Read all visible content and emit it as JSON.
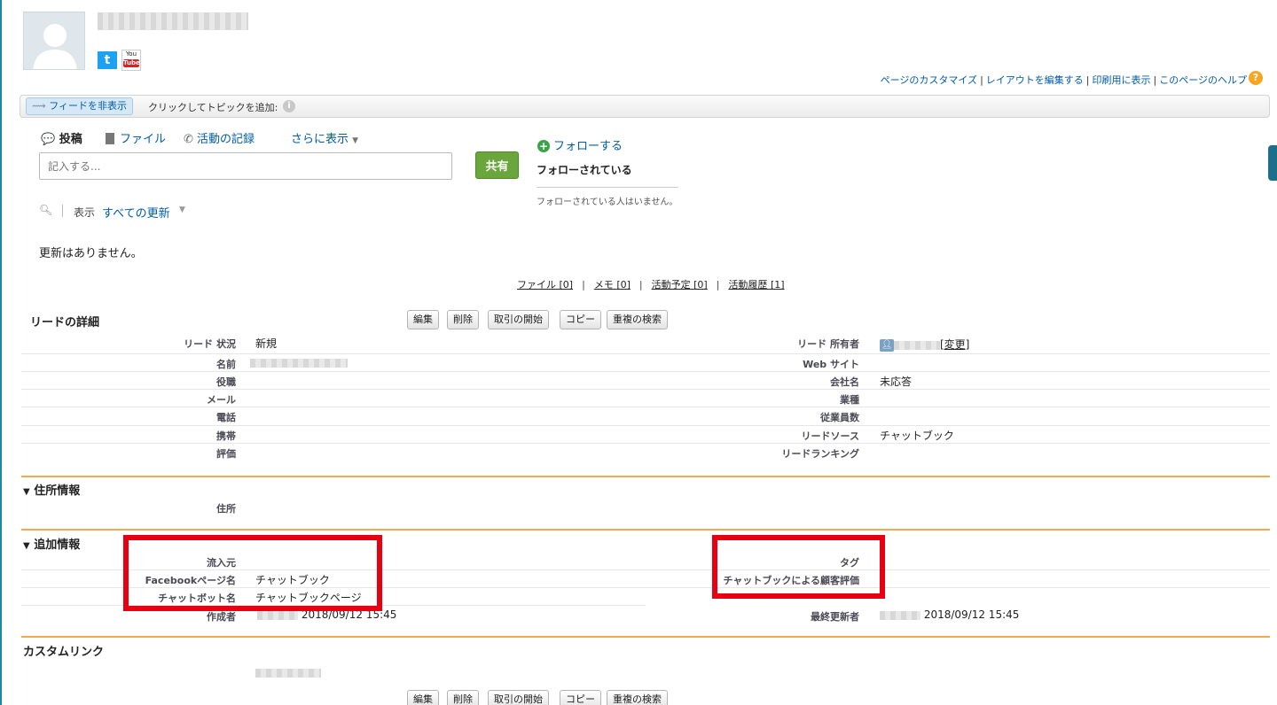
{
  "header": {
    "toplinks": [
      "ページのカスタマイズ",
      "レイアウトを編集する",
      "印刷用に表示",
      "このページのヘルプ"
    ]
  },
  "feed": {
    "hide_feed": "フィードを非表示",
    "add_topic": "クリックしてトピックを追加:",
    "tabs": [
      "投稿",
      "ファイル",
      "活動の記録",
      "さらに表示"
    ],
    "input_placeholder": "記入する...",
    "share": "共有",
    "follow": "フォローする",
    "followers_title": "フォローされている",
    "no_followers": "フォローされている人はいません。",
    "filter_label": "表示",
    "filter_value": "すべての更新",
    "no_updates": "更新はありません。"
  },
  "related_links": [
    {
      "label": "ファイル",
      "count": "[0]"
    },
    {
      "label": "メモ",
      "count": "[0]"
    },
    {
      "label": "活動予定",
      "count": "[0]"
    },
    {
      "label": "活動履歴",
      "count": "[1]"
    }
  ],
  "detail": {
    "title": "リードの詳細",
    "buttons": [
      "編集",
      "削除",
      "取引の開始",
      "コピー",
      "重複の検索"
    ],
    "left": [
      {
        "label": "リード 状況",
        "value": "新規"
      },
      {
        "label": "名前",
        "value": ""
      },
      {
        "label": "役職",
        "value": ""
      },
      {
        "label": "メール",
        "value": ""
      },
      {
        "label": "電話",
        "value": ""
      },
      {
        "label": "携帯",
        "value": ""
      },
      {
        "label": "評価",
        "value": ""
      }
    ],
    "right": [
      {
        "label": "リード 所有者",
        "value": "[変更]"
      },
      {
        "label": "Web サイト",
        "value": ""
      },
      {
        "label": "会社名",
        "value": "未応答"
      },
      {
        "label": "業種",
        "value": ""
      },
      {
        "label": "従業員数",
        "value": ""
      },
      {
        "label": "リードソース",
        "value": "チャットブック"
      },
      {
        "label": "リードランキング",
        "value": ""
      }
    ]
  },
  "address": {
    "title": "住所情報",
    "label": "住所"
  },
  "additional": {
    "title": "追加情報",
    "left": [
      {
        "label": "流入元",
        "value": ""
      },
      {
        "label": "Facebookページ名",
        "value": "チャットブック"
      },
      {
        "label": "チャットボット名",
        "value": "チャットブックページ"
      }
    ],
    "right": [
      {
        "label": "タグ",
        "value": ""
      },
      {
        "label": "チャットブックによる顧客評価",
        "value": ""
      }
    ],
    "created_label": "作成者",
    "created_date": "2018/09/12 15:45",
    "modified_label": "最終更新者",
    "modified_date": "2018/09/12 15:45"
  },
  "custom_links": {
    "title": "カスタムリンク"
  },
  "colors": {
    "link": "#015ba7",
    "section_line": "#f2a950",
    "highlight": "#e60012",
    "share_button": "#6aa63c"
  }
}
